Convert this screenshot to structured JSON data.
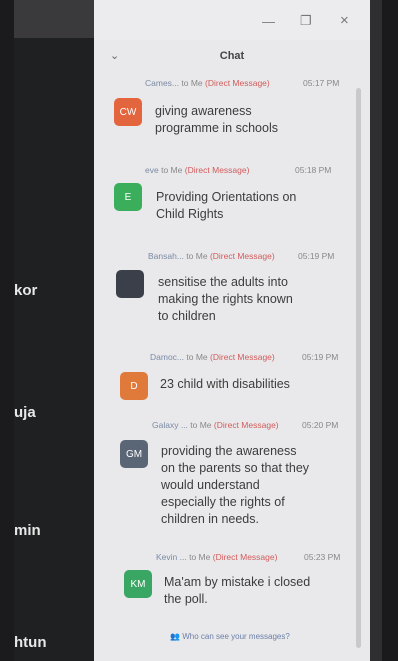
{
  "participants": [
    "kor",
    "uja",
    "min",
    "htun"
  ],
  "chat": {
    "title": "Chat",
    "footer": "Who can see your messages?",
    "messages": [
      {
        "sender": "Cames...",
        "to": "to Me",
        "type": "(Direct Message)",
        "time": "05:17 PM",
        "initials": "CW",
        "color": "#e3653e",
        "text": "giving awareness\nprogramme in schools"
      },
      {
        "sender": "eve",
        "to": "to Me",
        "type": "(Direct Message)",
        "time": "05:18 PM",
        "initials": "E",
        "color": "#3aae5b",
        "text": "Providing Orientations on\nChild Rights"
      },
      {
        "sender": "Bansah...",
        "to": "to Me",
        "type": "(Direct Message)",
        "time": "05:19 PM",
        "initials": "",
        "color": "#3b3f4a",
        "text": "sensitise the adults into\nmaking the rights known\nto children"
      },
      {
        "sender": "Damoc...",
        "to": "to Me",
        "type": "(Direct Message)",
        "time": "05:19 PM",
        "initials": "D",
        "color": "#e07a3a",
        "text": "23 child with disabilities"
      },
      {
        "sender": "Galaxy ...",
        "to": "to Me",
        "type": "(Direct Message)",
        "time": "05:20 PM",
        "initials": "GM",
        "color": "#5a6676",
        "text": "providing the awareness\non the parents so that they\nwould understand\nespecially the rights of\nchildren in needs."
      },
      {
        "sender": "Kevin ...",
        "to": "to Me",
        "type": "(Direct Message)",
        "time": "05:23 PM",
        "initials": "KM",
        "color": "#3aa664",
        "text": "Ma'am by mistake i closed\nthe poll."
      }
    ]
  }
}
